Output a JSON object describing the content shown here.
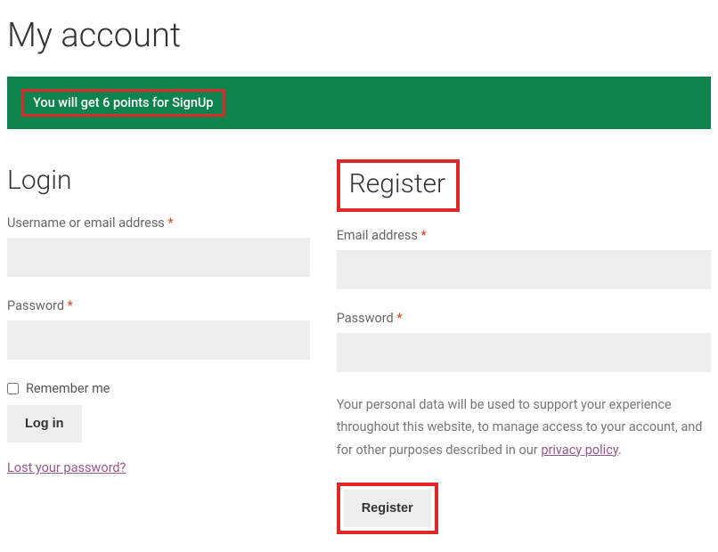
{
  "page_title": "My account",
  "notice": "You will get 6 points for SignUp",
  "login": {
    "heading": "Login",
    "username_label": "Username or email address ",
    "password_label": "Password ",
    "remember_label": "Remember me",
    "submit_label": "Log in",
    "lost_password_label": "Lost your password?"
  },
  "register": {
    "heading": "Register",
    "email_label": "Email address ",
    "password_label": "Password ",
    "privacy_text_pre": "Your personal data will be used to support your experience throughout this website, to manage access to your account, and for other purposes described in our ",
    "privacy_link_label": "privacy policy",
    "privacy_text_post": ".",
    "submit_label": "Register"
  },
  "required_mark": "*"
}
